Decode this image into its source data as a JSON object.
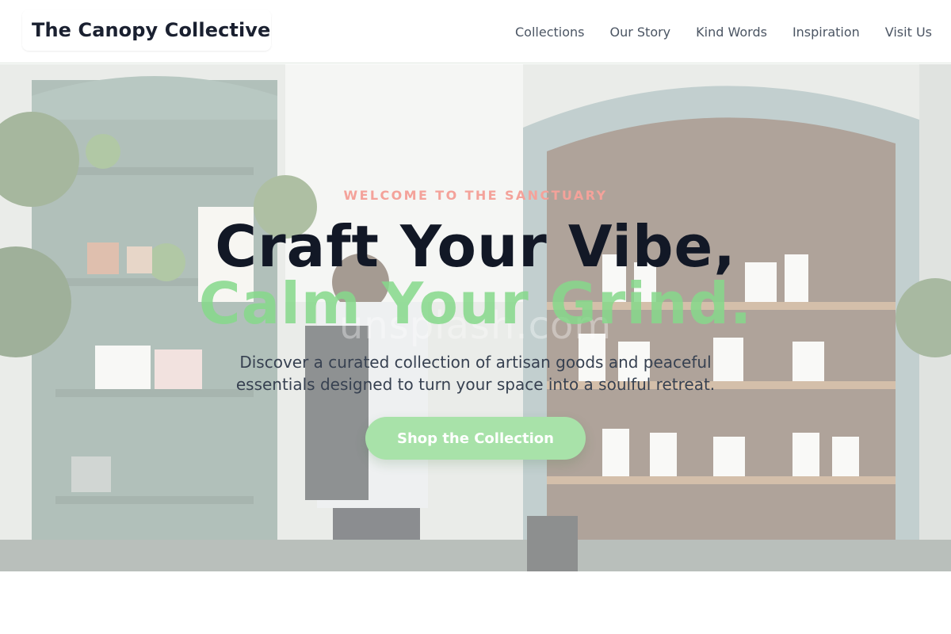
{
  "nav": {
    "brand": "The Canopy Collective",
    "links": [
      "Collections",
      "Our Story",
      "Kind Words",
      "Inspiration",
      "Visit Us"
    ]
  },
  "hero": {
    "eyebrow": "WELCOME TO THE SANCTUARY",
    "headline_line1": "Craft Your Vibe,",
    "headline_line2": "Calm Your Grind.",
    "watermark": "unsplash.com",
    "subtitle": "Discover a curated collection of artisan goods and peaceful essentials designed to turn your space into a soulful retreat.",
    "cta_label": "Shop the Collection"
  },
  "colors": {
    "accent_green": "#86d98b",
    "button_green": "#a8e2a9",
    "eyebrow_pink": "#f4a29a",
    "heading_dark": "#121826"
  }
}
